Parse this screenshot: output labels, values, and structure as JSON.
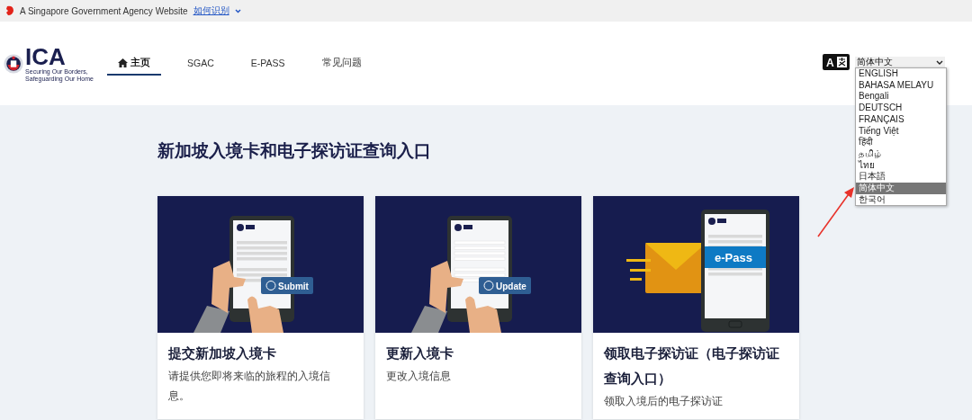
{
  "top_banner": {
    "text": "A Singapore Government Agency Website",
    "link": "如何识别"
  },
  "logo": {
    "name": "ICA",
    "tagline": [
      "Securing Our Borders,",
      "Safeguarding Our Home"
    ]
  },
  "nav": [
    {
      "label": "主页",
      "selected": true,
      "kind": "home"
    },
    {
      "label": "SGAC",
      "selected": false,
      "kind": "text"
    },
    {
      "label": "E-PASS",
      "selected": false,
      "kind": "text"
    },
    {
      "label": "常见问题",
      "selected": false,
      "kind": "text"
    }
  ],
  "language": {
    "icon_label": "A",
    "value": "简体中文",
    "expanded": true,
    "options": [
      {
        "label": "ENGLISH",
        "selected": false
      },
      {
        "label": "BAHASA MELAYU",
        "selected": false
      },
      {
        "label": "Bengali",
        "selected": false
      },
      {
        "label": "DEUTSCH",
        "selected": false
      },
      {
        "label": "FRANÇAIS",
        "selected": false
      },
      {
        "label": "Tiếng Việt",
        "selected": false
      },
      {
        "label": "हिंदी",
        "selected": false
      },
      {
        "label": "தமிழ்",
        "selected": false
      },
      {
        "label": "ไทย",
        "selected": false
      },
      {
        "label": "日本語",
        "selected": false
      },
      {
        "label": "简体中文",
        "selected": true
      },
      {
        "label": "한국어",
        "selected": false
      }
    ]
  },
  "page_title": "新加坡入境卡和电子探访证查询入口",
  "cards": [
    {
      "kind": "submit",
      "illustration_label": "Submit",
      "title": "提交新加坡入境卡",
      "description": "请提供您即将来临的旅程的入境信息。"
    },
    {
      "kind": "update",
      "illustration_label": "Update",
      "title": "更新入境卡",
      "description": "更改入境信息"
    },
    {
      "kind": "epass",
      "illustration_label": "e-Pass",
      "title": "领取电子探访证（电子探访证查询入口）",
      "description": "领取入境后的电子探访证"
    }
  ]
}
